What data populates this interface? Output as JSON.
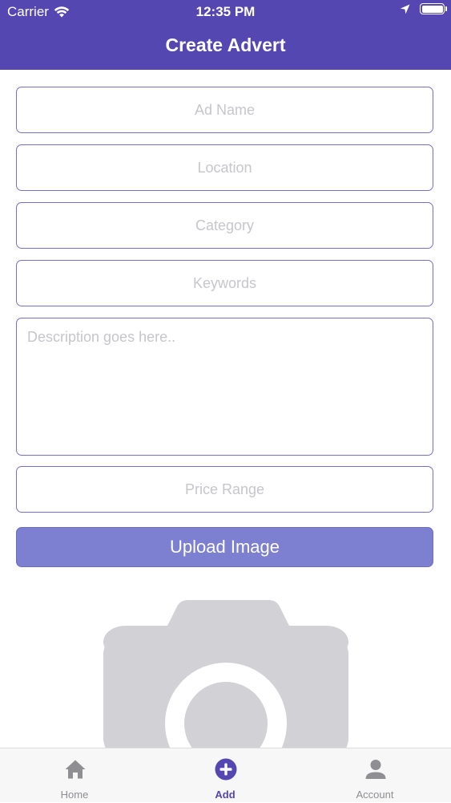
{
  "status_bar": {
    "carrier": "Carrier",
    "time": "12:35 PM"
  },
  "header": {
    "title": "Create Advert"
  },
  "form": {
    "ad_name_placeholder": "Ad Name",
    "location_placeholder": "Location",
    "category_placeholder": "Category",
    "keywords_placeholder": "Keywords",
    "description_placeholder": "Description goes here..",
    "price_range_placeholder": "Price Range",
    "upload_label": "Upload Image"
  },
  "tabs": [
    {
      "label": "Home",
      "icon": "home-icon"
    },
    {
      "label": "Add",
      "icon": "add-circle-icon"
    },
    {
      "label": "Account",
      "icon": "person-icon"
    }
  ],
  "colors": {
    "primary": "#5547b2",
    "button": "#7d7fd1",
    "field_border": "#7670c9",
    "placeholder": "#c6c6cb",
    "tab_inactive": "#8e8e93",
    "camera": "#d1d1d6"
  }
}
